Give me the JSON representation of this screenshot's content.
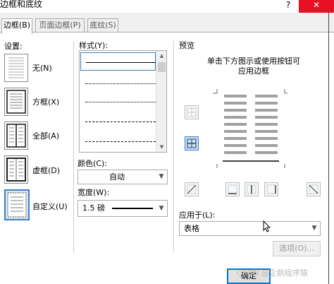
{
  "window": {
    "title": "边框和底纹",
    "help": "?",
    "close": "✕"
  },
  "tabs": [
    {
      "label": "边框(B)",
      "active": true
    },
    {
      "label": "页面边框(P)",
      "active": false
    },
    {
      "label": "底纹(S)",
      "active": false
    }
  ],
  "settings": {
    "heading": "设置:",
    "items": [
      {
        "label": "无(N)",
        "icon": "border-none-icon"
      },
      {
        "label": "方框(X)",
        "icon": "border-box-icon"
      },
      {
        "label": "全部(A)",
        "icon": "border-all-icon"
      },
      {
        "label": "虚框(D)",
        "icon": "border-grid-icon"
      },
      {
        "label": "自定义(U)",
        "icon": "border-custom-icon",
        "selected": true
      }
    ]
  },
  "style": {
    "heading": "样式(Y):",
    "options": [
      "solid",
      "dotted",
      "dash-dot-small",
      "dashed",
      "dash-dot"
    ]
  },
  "color": {
    "heading": "颜色(C):",
    "value": "自动"
  },
  "width": {
    "heading": "宽度(W):",
    "value": "1.5 磅"
  },
  "preview": {
    "heading": "预览",
    "instruction_line1": "单击下方图示或使用按钮可",
    "instruction_line2": "应用边框"
  },
  "apply_to": {
    "heading": "应用于(L):",
    "value": "表格"
  },
  "buttons": {
    "options": "选项(O)...",
    "ok": "确定"
  },
  "watermark": "CSDN @企鹅程序猿",
  "colors": {
    "accent": "#3c7fc0",
    "close_red": "#e81123",
    "preview_gray": "#a0a0a0"
  }
}
